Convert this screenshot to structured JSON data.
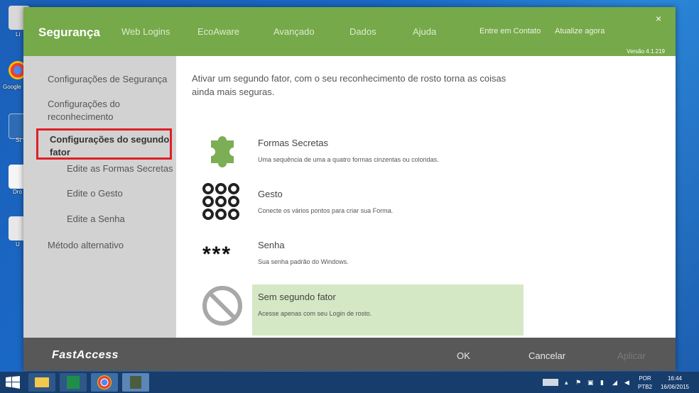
{
  "desktop": {
    "icons": [
      {
        "label": "Li"
      },
      {
        "label": "Google"
      },
      {
        "label": "St"
      },
      {
        "label": "Dro"
      },
      {
        "label": "U"
      }
    ]
  },
  "header": {
    "brand": "Segurança",
    "nav": [
      "Web Logins",
      "EcoAware",
      "Avançado",
      "Dados",
      "Ajuda"
    ],
    "contact": "Entre em Contato",
    "update": "Atualize agora",
    "version": "Versão 4.1.219",
    "close": "×"
  },
  "sidebar": {
    "item1": "Configurações de Segurança",
    "item2_line1": "Configurações do",
    "item2_line2": "reconhecimento",
    "active_line1": "Configurações do segundo",
    "active_line2": "fator",
    "sub1": "Edite as Formas Secretas",
    "sub2": "Edite o Gesto",
    "sub3": "Edite a Senha",
    "item4": "Método alternativo"
  },
  "content": {
    "intro_line1": "Ativar um segundo fator, com o seu reconhecimento de rosto torna as coisas",
    "intro_line2": "ainda mais seguras.",
    "options": [
      {
        "title": "Formas Secretas",
        "desc": "Uma sequência de uma a quatro formas cinzentas ou coloridas.",
        "icon": "puzzle-icon"
      },
      {
        "title": "Gesto",
        "desc": "Conecte os vários pontos para criar sua Forma.",
        "icon": "gesture-dots-icon"
      },
      {
        "title": "Senha",
        "desc": "Sua senha padrão do Windows.",
        "icon": "asterisks-icon",
        "symbol": "***"
      },
      {
        "title": "Sem segundo fator",
        "desc": "Acesse apenas com seu Login de rosto.",
        "icon": "prohibited-icon"
      }
    ]
  },
  "footer": {
    "logo": "FastAccess",
    "ok": "OK",
    "cancel": "Cancelar",
    "apply": "Aplicar"
  },
  "taskbar": {
    "lang_top": "POR",
    "lang_bottom": "PTB2",
    "time": "16:44",
    "date": "16/06/2015"
  },
  "colors": {
    "header_green": "#75a94a",
    "selected_bg": "#d5e8c5",
    "highlight_red": "#e01f26"
  }
}
